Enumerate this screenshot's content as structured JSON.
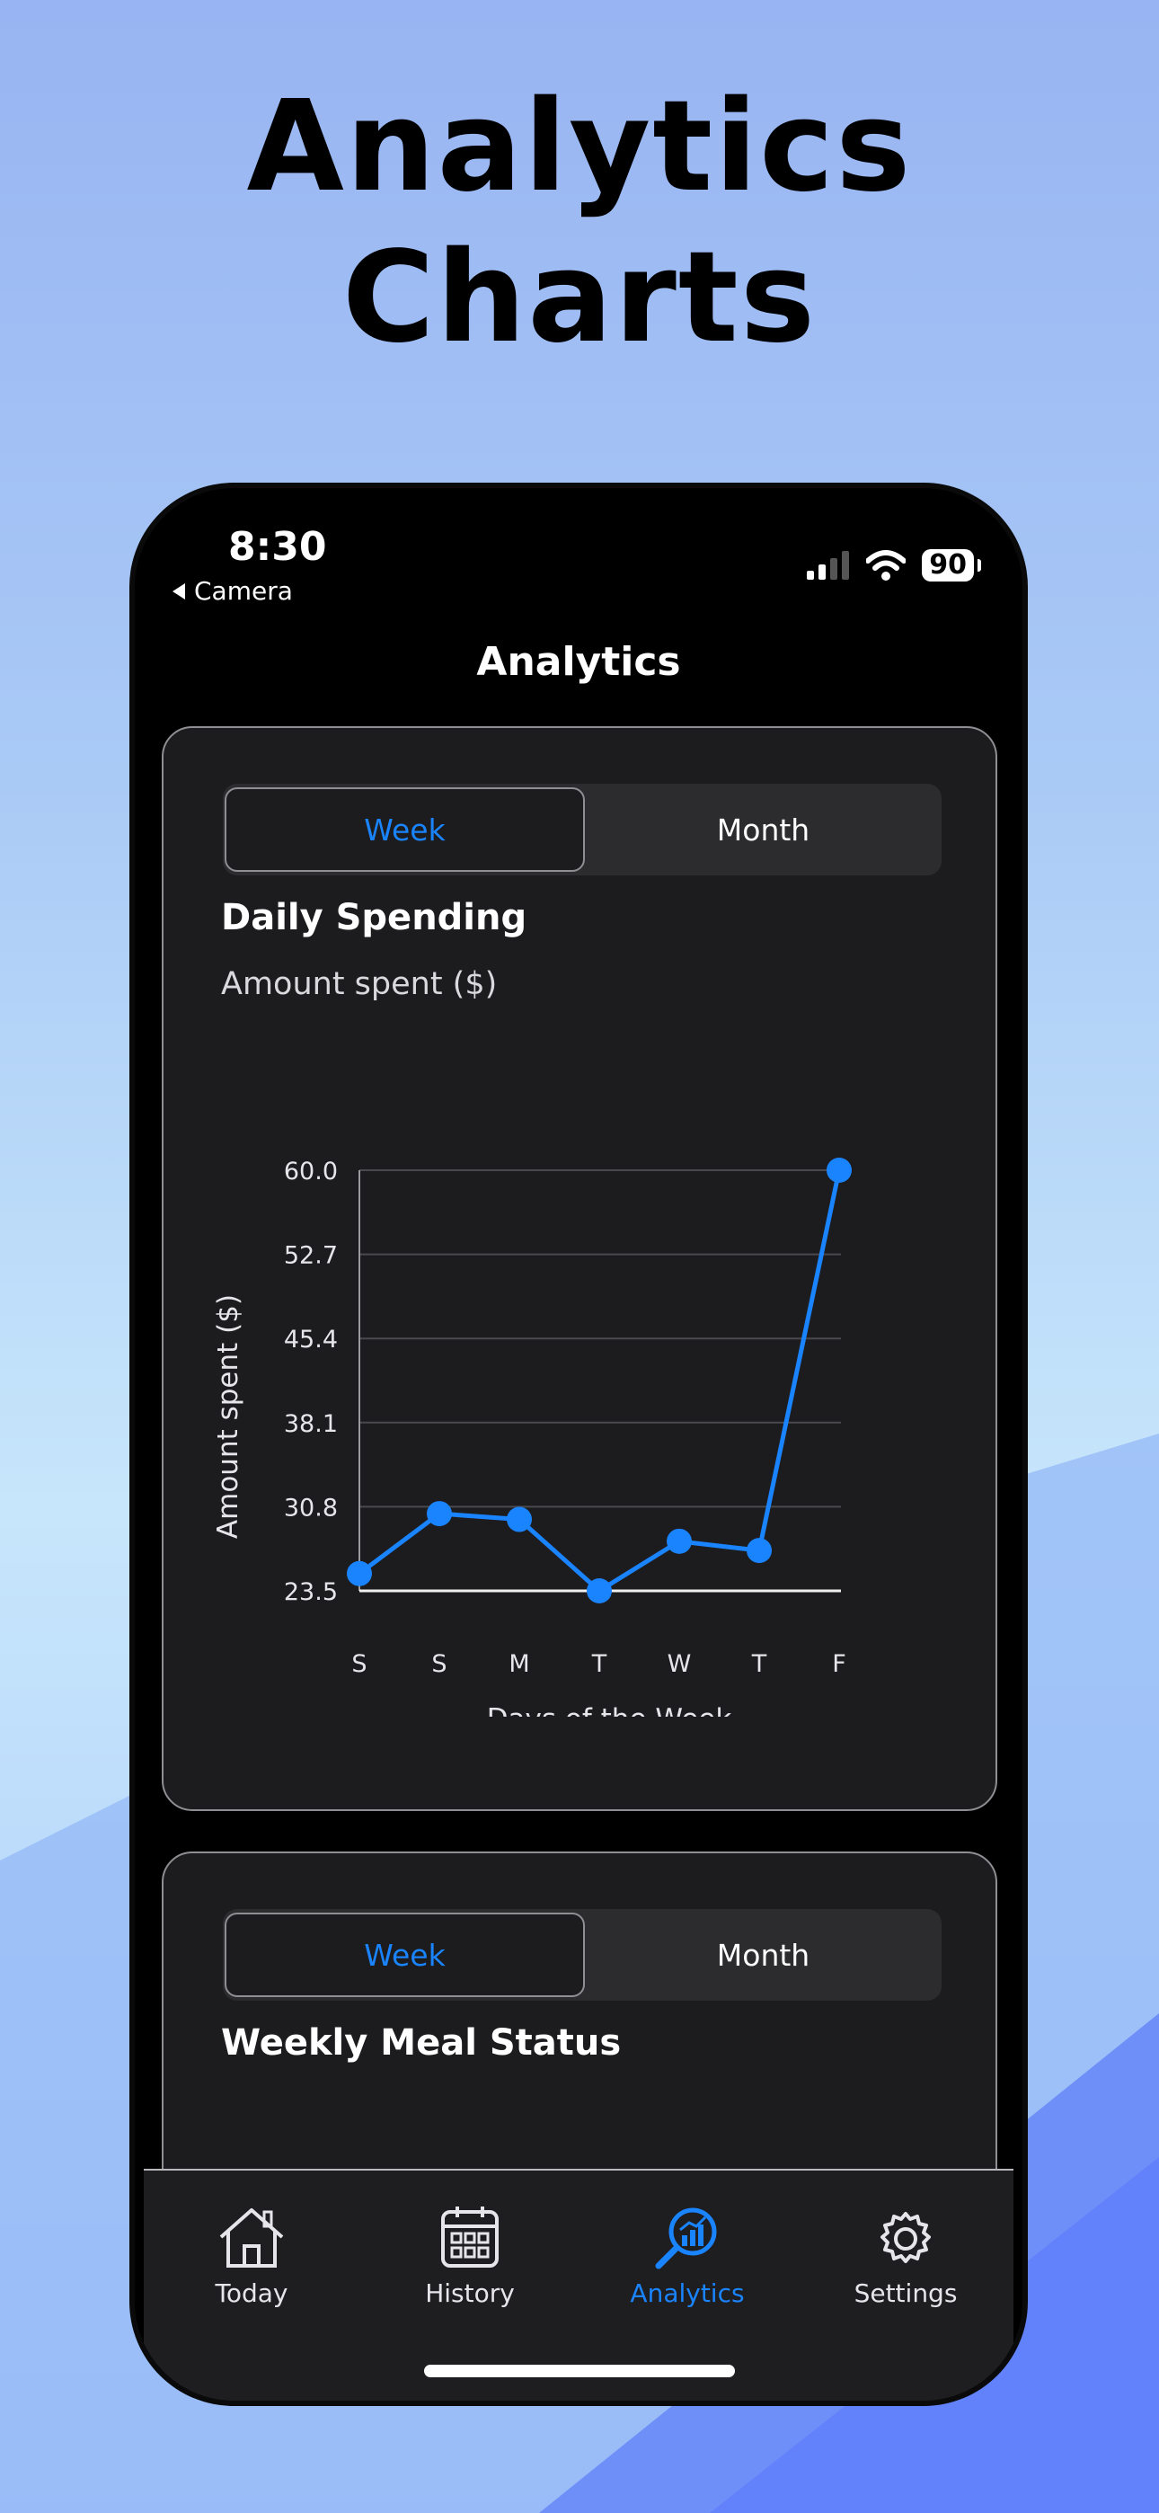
{
  "promo": {
    "line1": "Analytics",
    "line2": "Charts"
  },
  "status_bar": {
    "time": "8:30",
    "back_label": "Camera",
    "battery": "90"
  },
  "nav": {
    "title": "Analytics"
  },
  "colors": {
    "accent": "#1a84ff",
    "card_bg": "#1c1c1e",
    "phone_bg": "#000000"
  },
  "spending_card": {
    "segments": {
      "week": "Week",
      "month": "Month",
      "selected": "Week"
    },
    "title": "Daily Spending",
    "subtitle": "Amount spent ($)"
  },
  "meal_card": {
    "segments": {
      "week": "Week",
      "month": "Month",
      "selected": "Week"
    },
    "title": "Weekly Meal Status"
  },
  "chart_data": {
    "type": "line",
    "categories": [
      "S",
      "S",
      "M",
      "T",
      "W",
      "T",
      "F"
    ],
    "values": [
      25.0,
      30.2,
      29.7,
      23.5,
      27.8,
      27.0,
      60.0
    ],
    "xlabel": "Davs of the Week",
    "ylabel": "Amount spent ($)",
    "ylim": [
      23.5,
      60.0
    ],
    "yticks": [
      "23.5",
      "30.8",
      "38.1",
      "45.4",
      "52.7",
      "60.0"
    ],
    "grid": true,
    "color": "#1a84ff"
  },
  "tabbar": {
    "items": [
      {
        "label": "Today",
        "icon": "house-icon"
      },
      {
        "label": "History",
        "icon": "calendar-icon"
      },
      {
        "label": "Analytics",
        "icon": "analytics-magnifier-icon",
        "active": true
      },
      {
        "label": "Settings",
        "icon": "gear-icon"
      }
    ]
  }
}
